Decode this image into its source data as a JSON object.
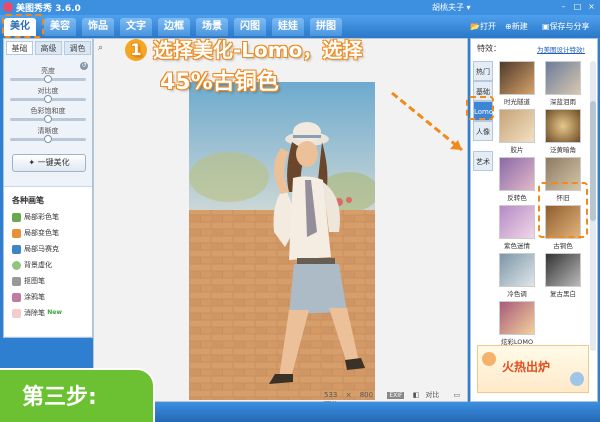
{
  "titlebar": {
    "app_title": "美图秀秀 3.6.0",
    "user": "胡桃夫子 ▾",
    "minimize": "–",
    "maximize": "□",
    "close": "×"
  },
  "top_tabs": [
    "美化",
    "美容",
    "饰品",
    "文字",
    "边框",
    "场景",
    "闪图",
    "娃娃",
    "拼图"
  ],
  "top_actions": {
    "open": "打开",
    "new": "新建",
    "save": "保存与分享"
  },
  "left": {
    "subtabs": [
      "基础",
      "高级",
      "调色"
    ],
    "adjustments": [
      {
        "label": "亮度",
        "level": 0.5
      },
      {
        "label": "对比度",
        "level": 0.5
      },
      {
        "label": "色彩饱和度",
        "level": 0.5
      },
      {
        "label": "清晰度",
        "level": 0.5
      }
    ],
    "reset_icon": "reset-icon",
    "one_click": "一键美化",
    "brush_title": "各种画笔",
    "brushes": [
      "局部彩色笔",
      "局部变色笔",
      "局部马赛克",
      "背景虚化",
      "抠图笔",
      "涂鸦笔",
      "消除笔"
    ],
    "brush_new_badge": "New"
  },
  "canvas": {
    "size_w": "533",
    "size_x": "×",
    "size_h": "800",
    "exif": "EXIF",
    "compare": "对比",
    "preview": "预览"
  },
  "right": {
    "title": "特效：",
    "link": "为美图设计特效!",
    "categories": [
      "热门",
      "基础",
      "Lomo",
      "人像",
      "艺术"
    ],
    "active_category": "Lomo",
    "effects": [
      "时光隧道",
      "深蓝泪雨",
      "胶片",
      "泛黄暗角",
      "反转色",
      "怀旧",
      "紫色迷情",
      "古铜色",
      "冷色调",
      "复古黑白",
      "炫彩LOMO"
    ],
    "ad_text": "火热出炉"
  },
  "annotation": {
    "step_num": "1",
    "line1": "选择美化-Lomo，选择",
    "line2": "45%古铜色",
    "step_label": "第三步:"
  },
  "colors": {
    "accent": "#2a78c9",
    "annotation": "#f08a1a",
    "step_green": "#6bc132"
  }
}
